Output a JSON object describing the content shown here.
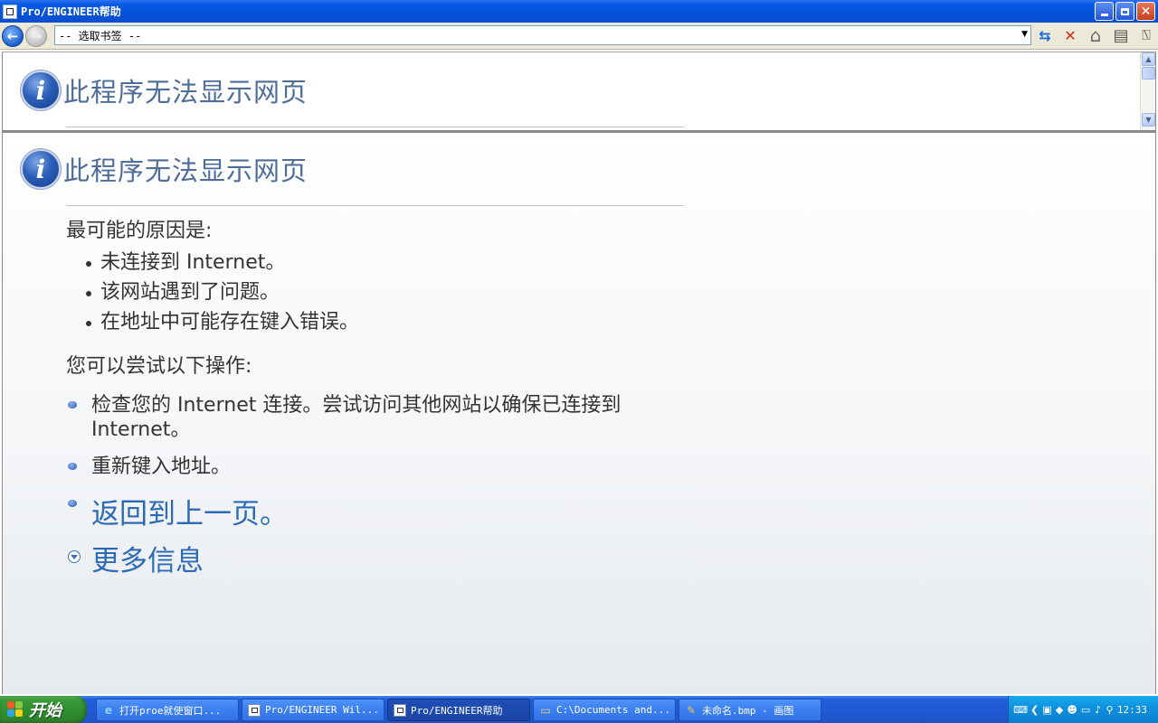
{
  "window": {
    "title": "Pro/ENGINEER帮助"
  },
  "toolbar": {
    "bookmark_select": "-- 选取书签 --"
  },
  "top_pane": {
    "title": "此程序无法显示网页"
  },
  "main_pane": {
    "title": "此程序无法显示网页",
    "reasons_title": "最可能的原因是:",
    "reasons": [
      {
        "text": "未连接到 Internet。"
      },
      {
        "text": "该网站遇到了问题。"
      },
      {
        "text": "在地址中可能存在键入错误。"
      }
    ],
    "try_title": "您可以尝试以下操作:",
    "try_items": {
      "check": "检查您的 Internet 连接。尝试访问其他网站以确保已连接到 Internet。",
      "retype": "重新键入地址。",
      "back": "返回到上一页。",
      "more": "更多信息"
    }
  },
  "taskbar": {
    "start": "开始",
    "tasks": [
      {
        "label": "打开proe就使窗口...",
        "icon": "ie-icon"
      },
      {
        "label": "Pro/ENGINEER Wil...",
        "icon": "window-icon"
      },
      {
        "label": "Pro/ENGINEER帮助",
        "icon": "window-icon"
      },
      {
        "label": "C:\\Documents and...",
        "icon": "folder-icon"
      },
      {
        "label": "未命名.bmp - 画图",
        "icon": "paint-icon"
      }
    ],
    "clock": "12:33"
  }
}
